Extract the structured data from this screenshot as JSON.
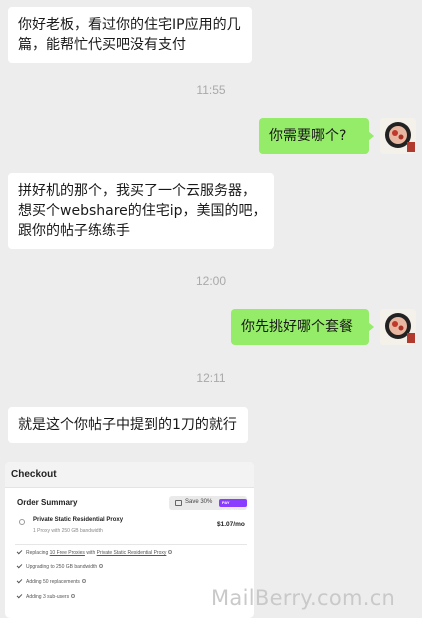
{
  "messages": {
    "m1_line1": "你好老板，看过你的住宅IP应用的几",
    "m1_line2": "篇，能帮忙代买吧没有支付",
    "ts1": "11:55",
    "m2": "你需要哪个?",
    "m3_line1": "拼好机的那个，我买了一个云服务器，",
    "m3_line2": "想买个webshare的住宅ip，美国的吧，",
    "m3_line3": "跟你的帖子练练手",
    "ts2": "12:00",
    "m4": "你先挑好哪个套餐",
    "ts3": "12:11",
    "m5": "就是这个你帖子中提到的1刀的就行"
  },
  "checkout": {
    "header": "Checkout",
    "order_summary": "Order Summary",
    "save_label": "Save 30%",
    "badge": "PAY YEARLY",
    "plan_name": "Private Static Residential Proxy",
    "plan_sub": "1 Proxy with 250 GB bandwidth",
    "price": "$1.07/mo",
    "f1_a": "Replacing ",
    "f1_b": "10 Free Proxies",
    "f1_c": " with ",
    "f1_d": "Private Static Residential Proxy",
    "f2": "Upgrading to 250 GB bandwidth",
    "f3": "Adding 50 replacements",
    "f4": "Adding 3 sub-users"
  },
  "watermark": "MailBerry.com.cn",
  "colors": {
    "background": "#ededed",
    "bubble_left": "#ffffff",
    "bubble_right": "#95ec69",
    "badge": "#8b3dff"
  }
}
